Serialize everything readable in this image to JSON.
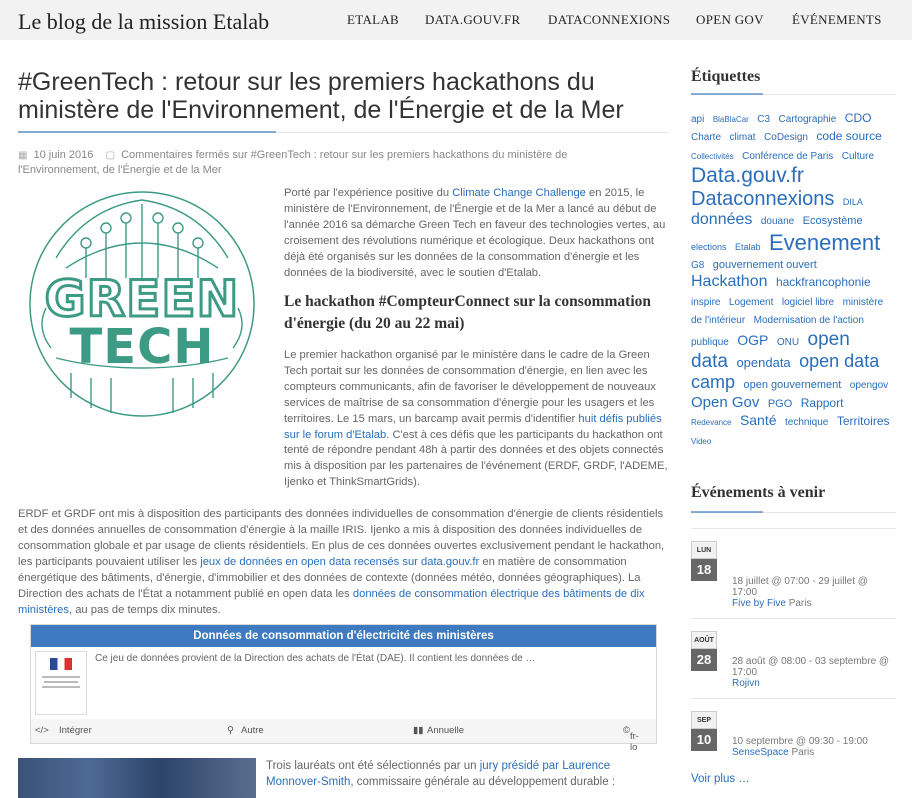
{
  "header": {
    "site_title": "Le blog de la mission Etalab",
    "nav": [
      "ETALAB",
      "DATA.GOUV.FR",
      "DATACONNEXIONS",
      "OPEN GOV",
      "ÉVÉNEMENTS"
    ]
  },
  "post": {
    "title": "#GreenTech : retour sur les premiers hackathons du ministère de l'Environnement, de l'Énergie et de la Mer",
    "date": "10 juin 2016",
    "comments": "Commentaires fermés sur #GreenTech : retour sur les premiers hackathons du ministère de l'Environnement, de l'Énergie et de la Mer",
    "logo_text": "GREEN TECH",
    "p1_a": "Porté par l'expérience positive du ",
    "p1_link": "Climate Change Challenge",
    "p1_b": " en 2015, le ministère de l'Environnement, de l'Énergie et de la Mer a lancé au début de l'année 2016 sa démarche Green Tech en faveur des technologies vertes, au croisement des révolutions numérique et écologique. Deux hackathons ont déjà été organisés sur les données de la consommation d'énergie et les données de la biodiversité, avec le soutien d'Etalab.",
    "h2": "Le hackathon #CompteurConnect sur la consommation d'énergie (du 20 au 22 mai)",
    "p2_a": "Le premier hackathon organisé par le ministère dans le cadre de la Green Tech portait sur les données de consommation d'énergie, en lien avec les compteurs communicants, afin de favoriser le développement de nouveaux services de maîtrise de sa consommation d'énergie pour les usagers et les territoires. Le 15 mars, un barcamp avait permis d'identifier ",
    "p2_link": "huit défis publiés sur le forum d'Etalab",
    "p2_b": ". C'est à ces défis que les participants du hackathon ont tenté de répondre pendant 48h à partir des données et des objets connectés mis à disposition par les partenaires de l'événement (ERDF, GRDF, l'ADEME, Ijenko et ThinkSmartGrids).",
    "p3_a": "ERDF et GRDF ont mis à disposition des participants des données individuelles de consommation d'énergie de clients résidentiels et des données annuelles de consommation d'énergie à la maille IRIS. Ijenko a mis à disposition des données individuelles de consommation globale et par usage de clients résidentiels. En plus de ces données ouvertes exclusivement pendant le hackathon, les participants pouvaient utiliser les ",
    "p3_link1": "jeux de données en open data recensés sur data.gouv.fr",
    "p3_b": " en matière de consommation énergétique des bâtiments, d'énergie, d'immobilier et des données de contexte (données météo, données géographiques). La Direction des achats de l'État a notamment publié en open data les ",
    "p3_link2": "données de consommation électrique des bâtiments de dix ministères",
    "p3_c": ", au pas de temps dix minutes.",
    "p4_a": "Trois lauréats ont été sélectionnés par un ",
    "p4_link": "jury présidé par Laurence Monnover-Smith",
    "p4_b": ", commissaire générale au développement durable :"
  },
  "dataset_card": {
    "title": "Données de consommation d'électricité des ministères",
    "description": "Ce jeu de données provient de la Direction des achats de l'État (DAE). Il contient les données de …",
    "embed": "Intégrer",
    "place": "Autre",
    "frequency": "Annuelle",
    "license": "fr-lo"
  },
  "sidebar": {
    "tags_title": "Étiquettes",
    "tags": [
      {
        "t": "api",
        "s": 10
      },
      {
        "t": "BlaBlaCar",
        "s": 8
      },
      {
        "t": "C3",
        "s": 10
      },
      {
        "t": "Cartographie",
        "s": 10
      },
      {
        "t": "CDO",
        "s": 12
      },
      {
        "t": "Charte",
        "s": 10
      },
      {
        "t": "climat",
        "s": 10
      },
      {
        "t": "CoDesign",
        "s": 10
      },
      {
        "t": "code source",
        "s": 12
      },
      {
        "t": "Collectivités",
        "s": 8
      },
      {
        "t": "Conférence de Paris",
        "s": 10
      },
      {
        "t": "Culture",
        "s": 10
      },
      {
        "t": "Data.gouv.fr",
        "s": 21
      },
      {
        "t": "Dataconnexions",
        "s": 20
      },
      {
        "t": "DILA",
        "s": 9
      },
      {
        "t": "données",
        "s": 16
      },
      {
        "t": "douane",
        "s": 10
      },
      {
        "t": "Ecosystème",
        "s": 11
      },
      {
        "t": "elections",
        "s": 9
      },
      {
        "t": "Etalab",
        "s": 9
      },
      {
        "t": "Evenement",
        "s": 22
      },
      {
        "t": "G8",
        "s": 10
      },
      {
        "t": "gouvernement ouvert",
        "s": 11
      },
      {
        "t": "Hackathon",
        "s": 16
      },
      {
        "t": "hackfrancophonie",
        "s": 12
      },
      {
        "t": "inspire",
        "s": 10
      },
      {
        "t": "Logement",
        "s": 10
      },
      {
        "t": "logiciel libre",
        "s": 10
      },
      {
        "t": "ministère",
        "s": 10
      },
      {
        "t": "de l'intérieur",
        "s": 10
      },
      {
        "t": "Modernisation de l'action",
        "s": 10
      },
      {
        "t": "publique",
        "s": 10
      },
      {
        "t": "OGP",
        "s": 14
      },
      {
        "t": "ONU",
        "s": 10
      },
      {
        "t": "open data",
        "s": 19
      },
      {
        "t": "opendata",
        "s": 13
      },
      {
        "t": "open data camp",
        "s": 18
      },
      {
        "t": "open gouvernement",
        "s": 11
      },
      {
        "t": "opengov",
        "s": 10
      },
      {
        "t": "Open Gov",
        "s": 15
      },
      {
        "t": "PGO",
        "s": 11
      },
      {
        "t": "Rapport",
        "s": 12
      },
      {
        "t": "Redevance",
        "s": 8
      },
      {
        "t": "Santé",
        "s": 14
      },
      {
        "t": "technique",
        "s": 10
      },
      {
        "t": "Territoires",
        "s": 12
      },
      {
        "t": "Video",
        "s": 8
      }
    ],
    "events_title": "Événements à venir",
    "events": [
      {
        "month": "LUN",
        "day": "18",
        "time": "18 juillet @ 07:00 - 29 juillet @ 17:00",
        "name": "Five by Five",
        "place": "Paris"
      },
      {
        "month": "AOÛT",
        "day": "28",
        "time": "28 août @ 08:00 - 03 septembre @ 17:00",
        "name": "Rojivn",
        "place": ""
      },
      {
        "month": "SEP",
        "day": "10",
        "time": "10 septembre @ 09:30 - 19:00",
        "name": "SenseSpace",
        "place": "Paris"
      }
    ],
    "more": "Voir plus …"
  }
}
